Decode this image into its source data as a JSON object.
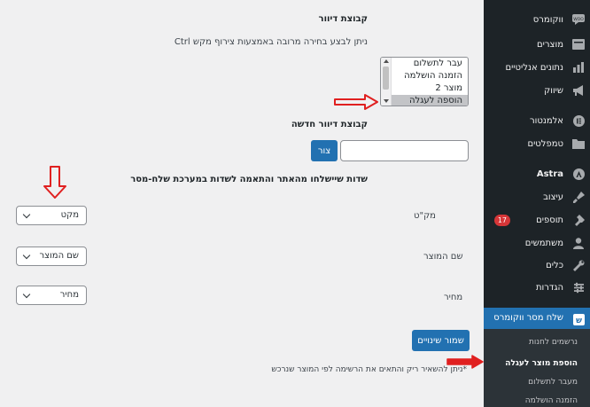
{
  "form": {
    "shipping_group_heading": "קבוצת דיוור",
    "multi_select_hint": "ניתן לבצע בחירה מרובה באמצעות צירוף מקש Ctrl",
    "groups": [
      "עבר לתשלום",
      "הזמנה הושלמה",
      "מוצר 2",
      "הוספה לעגלה"
    ],
    "selected_group": "הוספה לעגלה",
    "new_group_heading": "קבוצת דיוור חדשה",
    "new_group_value": "",
    "create_button": "צור",
    "mapping_heading": "שדות שיישלחו מהאתר והתאמה לשדות במערכת שלח-מסר",
    "mappings": [
      {
        "label": "מק\"ט",
        "value": "מקט"
      },
      {
        "label": "שם המוצר",
        "value": "שם המוצר"
      },
      {
        "label": "מחיר",
        "value": "מחיר"
      }
    ],
    "save_button": "שמור שינויים",
    "footnote": "*ניתן להשאיר ריק והתאים את הרשימה לפי המוצר שנרכש"
  },
  "sidebar": {
    "items": [
      {
        "label": "ווקומרס",
        "icon": "woo-icon"
      },
      {
        "label": "מוצרים",
        "icon": "products-icon"
      },
      {
        "label": "נתונים אנליטיים",
        "icon": "analytics-icon"
      },
      {
        "label": "שיווק",
        "icon": "megaphone-icon"
      },
      {
        "label": "אלמנטור",
        "icon": "elementor-icon"
      },
      {
        "label": "טמפלטים",
        "icon": "folder-icon"
      },
      {
        "label": "Astra",
        "icon": "astra-icon"
      },
      {
        "label": "עיצוב",
        "icon": "brush-icon"
      },
      {
        "label": "תוספים",
        "icon": "plugin-icon",
        "badge": "17"
      },
      {
        "label": "משתמשים",
        "icon": "user-icon"
      },
      {
        "label": "כלים",
        "icon": "wrench-icon"
      },
      {
        "label": "הגדרות",
        "icon": "settings-icon"
      }
    ],
    "active": {
      "label": "שלח מסר ווקומרס",
      "icon": "plugin-logo-icon"
    },
    "submenu": [
      "נרשמים לחנות",
      "הוספת מוצר לעגלה",
      "מעבר לתשלום",
      "הזמנה הושלמה"
    ],
    "current_submenu": "הוספת מוצר לעגלה"
  },
  "colors": {
    "accent": "#2271b1",
    "annotation": "#e02020",
    "sidebar_bg": "#1d2327",
    "badge": "#d63638"
  }
}
